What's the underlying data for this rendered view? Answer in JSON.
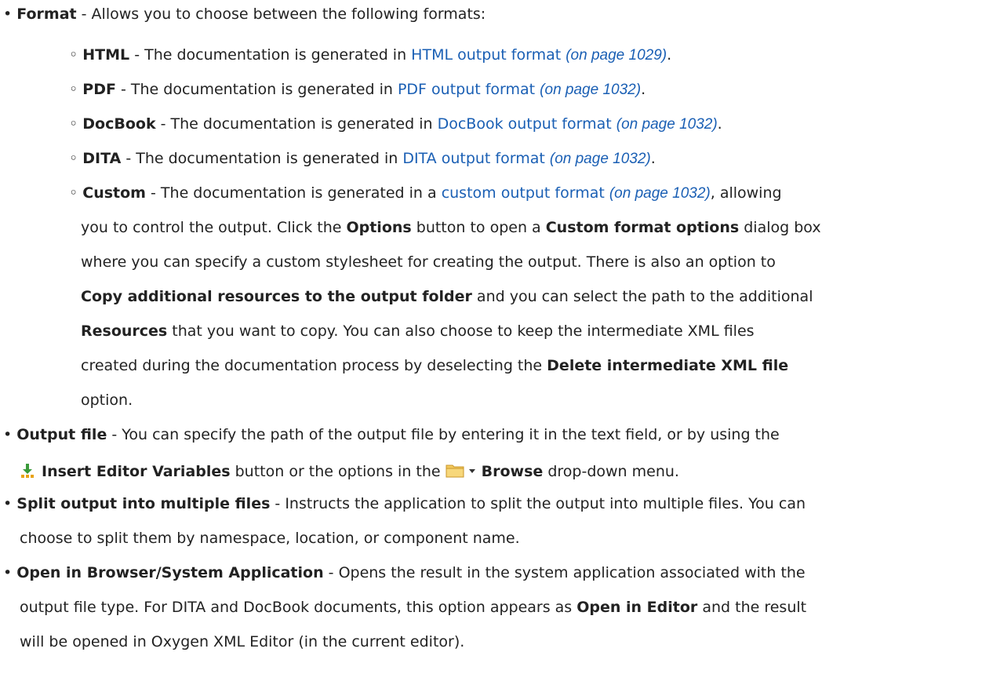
{
  "bullet": "•",
  "subbullet": "◦",
  "dash": " - ",
  "format": {
    "label": "Format",
    "desc": "Allows you to choose between the following formats:",
    "items": [
      {
        "name": "HTML",
        "prefix": "The documentation is generated in ",
        "link": "HTML output format",
        "page": "(on page 1029)",
        "suffix": "."
      },
      {
        "name": "PDF",
        "prefix": "The documentation is generated in ",
        "link": "PDF output format",
        "page": "(on page 1032)",
        "suffix": "."
      },
      {
        "name": "DocBook",
        "prefix": "The documentation is generated in ",
        "link": "DocBook output format",
        "page": "(on page 1032)",
        "suffix": "."
      },
      {
        "name": "DITA",
        "prefix": "The documentation is generated in ",
        "link": "DITA output format",
        "page": "(on page 1032)",
        "suffix": "."
      },
      {
        "name": "Custom",
        "prefix": "The documentation is generated in a ",
        "link": "custom output format",
        "page": "(on page 1032)",
        "suffix": ", allowing"
      }
    ],
    "custom": {
      "t1": "you to control the output. Click the ",
      "b1": "Options",
      "t2": " button to open a ",
      "b2": "Custom format options",
      "t3": " dialog box",
      "t4": "where you can specify a custom stylesheet for creating the output. There is also an option to",
      "b3": "Copy additional resources to the output folder",
      "t5": " and you can select the path to the additional",
      "b4": "Resources",
      "t6": " that you want to copy. You can also choose to keep the intermediate XML files",
      "t7": "created during the documentation process by deselecting the ",
      "b5": "Delete intermediate XML file",
      "t8": "option."
    }
  },
  "output": {
    "label": "Output file",
    "t1": "You can specify the path of the output file by entering it in the text field, or by using the",
    "b1": "Insert Editor Variables",
    "t2": " button or the options in the ",
    "b2": "Browse",
    "t3": " drop-down menu."
  },
  "split": {
    "label": "Split output into multiple files",
    "t1": "Instructs the application to split the output into multiple files. You can",
    "t2": "choose to split them by namespace, location, or component name."
  },
  "open": {
    "label": "Open in Browser/System Application",
    "t1": "Opens the result in the system application associated with the",
    "t2": "output file type. For DITA and DocBook documents, this option appears as ",
    "b1": "Open in Editor",
    "t3": " and the result",
    "t4": "will be opened in Oxygen XML Editor (in the current editor)."
  },
  "colors": {
    "text": "#222222",
    "link": "#1a5fb4",
    "folder": "#f4c95d",
    "insert_arrow": "#3a9a3a"
  },
  "icons": {
    "insert": "insert-editor-variables-icon",
    "folder": "folder-icon",
    "caret": "caret-down-icon"
  }
}
